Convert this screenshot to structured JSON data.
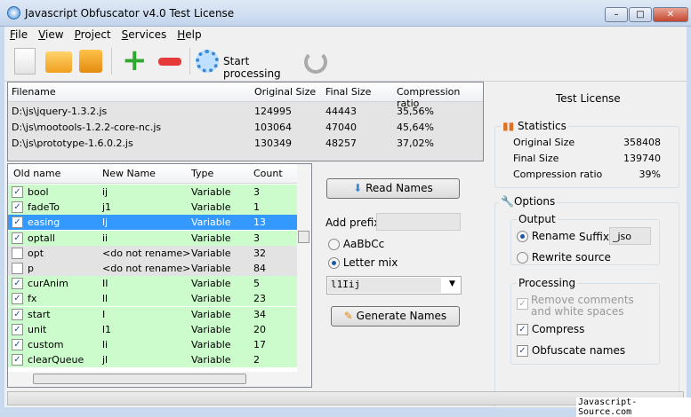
{
  "window": {
    "title": "Javascript Obfuscator v4.0  Test License",
    "min": "–",
    "max": "□",
    "close": "✕"
  },
  "menu": [
    {
      "label": "File",
      "u": "F",
      "rest": "ile"
    },
    {
      "label": "View",
      "u": "V",
      "rest": "iew"
    },
    {
      "label": "Project",
      "u": "P",
      "rest": "roject"
    },
    {
      "label": "Services",
      "u": "S",
      "rest": "ervices"
    },
    {
      "label": "Help",
      "u": "H",
      "rest": "elp"
    }
  ],
  "toolbar": {
    "start_processing": "Start processing"
  },
  "files": {
    "headers": [
      "Filename",
      "Original Size",
      "Final Size",
      "Compression ratio"
    ],
    "rows": [
      [
        "D:\\js\\jquery-1.3.2.js",
        "124995",
        "44443",
        "35,56%"
      ],
      [
        "D:\\js\\mootools-1.2.2-core-nc.js",
        "103064",
        "47040",
        "45,64%"
      ],
      [
        "D:\\js\\prototype-1.6.0.2.js",
        "130349",
        "48257",
        "37,02%"
      ]
    ]
  },
  "names": {
    "headers": [
      "Old name",
      "New Name",
      "Type",
      "Count"
    ],
    "rows": [
      {
        "old": "bool",
        "new": "ij",
        "type": "Variable",
        "count": "3",
        "checked": true
      },
      {
        "old": "fadeTo",
        "new": "j1",
        "type": "Variable",
        "count": "1",
        "checked": true
      },
      {
        "old": "easing",
        "new": "lj",
        "type": "Variable",
        "count": "13",
        "checked": true,
        "selected": true
      },
      {
        "old": "optall",
        "new": "ii",
        "type": "Variable",
        "count": "3",
        "checked": true
      },
      {
        "old": "opt",
        "new": "<do not rename>",
        "type": "Variable",
        "count": "32",
        "checked": false
      },
      {
        "old": "p",
        "new": "<do not rename>",
        "type": "Variable",
        "count": "84",
        "checked": false
      },
      {
        "old": "curAnim",
        "new": "II",
        "type": "Variable",
        "count": "5",
        "checked": true
      },
      {
        "old": "fx",
        "new": "ll",
        "type": "Variable",
        "count": "23",
        "checked": true
      },
      {
        "old": "start",
        "new": "I",
        "type": "Variable",
        "count": "34",
        "checked": true
      },
      {
        "old": "unit",
        "new": "l1",
        "type": "Variable",
        "count": "20",
        "checked": true
      },
      {
        "old": "custom",
        "new": "li",
        "type": "Variable",
        "count": "17",
        "checked": true
      },
      {
        "old": "clearQueue",
        "new": "jl",
        "type": "Variable",
        "count": "2",
        "checked": true
      }
    ]
  },
  "middle": {
    "read_names": "Read Names",
    "add_prefix": "Add prefix",
    "prefix_value": "",
    "radio_abc": "AaBbCc",
    "radio_mix": "Letter mix",
    "mix_selected": true,
    "charset": "l1Iij",
    "generate_names": "Generate Names"
  },
  "right": {
    "license": "Test License",
    "statistics": {
      "title": "Statistics",
      "rows": [
        [
          "Original Size",
          "358408"
        ],
        [
          "Final Size",
          "139740"
        ],
        [
          "Compression ratio",
          "39%"
        ]
      ]
    },
    "options": {
      "title": "Options",
      "output": "Output",
      "rename": "Rename",
      "suffix_label": "Suffix",
      "suffix": "_jso",
      "rewrite": "Rewrite source",
      "rename_selected": true,
      "processing": "Processing",
      "remove_comments": "Remove comments and white spaces",
      "compress": "Compress",
      "obfuscate": "Obfuscate names"
    }
  },
  "watermark": "Javascript-Source.com",
  "colors": {
    "checked_row": "#ccfccc",
    "unchecked_row": "#e3e3e3",
    "selected_row": "#3399ff"
  }
}
